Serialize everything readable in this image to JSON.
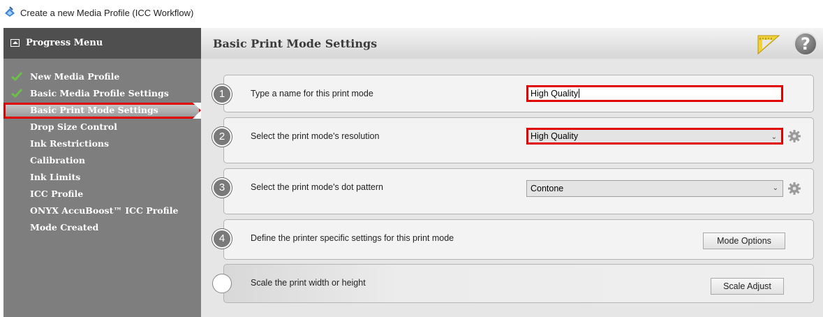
{
  "window": {
    "title": "Create a new Media Profile (ICC Workflow)"
  },
  "sidebar": {
    "header": "Progress Menu",
    "items": [
      {
        "label": "New Media Profile",
        "status": "done"
      },
      {
        "label": "Basic Media Profile Settings",
        "status": "done"
      },
      {
        "label": "Basic Print Mode Settings",
        "status": "active"
      },
      {
        "label": "Drop Size Control",
        "status": "pending"
      },
      {
        "label": "Ink Restrictions",
        "status": "pending"
      },
      {
        "label": "Calibration",
        "status": "pending"
      },
      {
        "label": "Ink Limits",
        "status": "pending"
      },
      {
        "label": "ICC Profile",
        "status": "pending"
      },
      {
        "label": "ONYX AccuBoost™ ICC Profile",
        "status": "pending"
      },
      {
        "label": "Mode Created",
        "status": "pending"
      }
    ]
  },
  "main": {
    "title": "Basic Print Mode Settings",
    "help_glyph": "?",
    "steps": [
      {
        "number": "1",
        "label": "Type a name for this print mode",
        "value": "High Quality"
      },
      {
        "number": "2",
        "label": "Select the print mode's resolution",
        "value": "High Quality"
      },
      {
        "number": "3",
        "label": "Select the print mode's dot pattern",
        "value": "Contone"
      },
      {
        "number": "4",
        "label": "Define the printer specific settings for this print mode",
        "button": "Mode Options"
      },
      {
        "number": "",
        "label": "Scale the print width or height",
        "button": "Scale Adjust"
      }
    ]
  },
  "colors": {
    "highlight": "#e00000",
    "check": "#6cc04a",
    "sidebar": "#7e7e7e",
    "sidebar_header": "#4f4f4f"
  }
}
